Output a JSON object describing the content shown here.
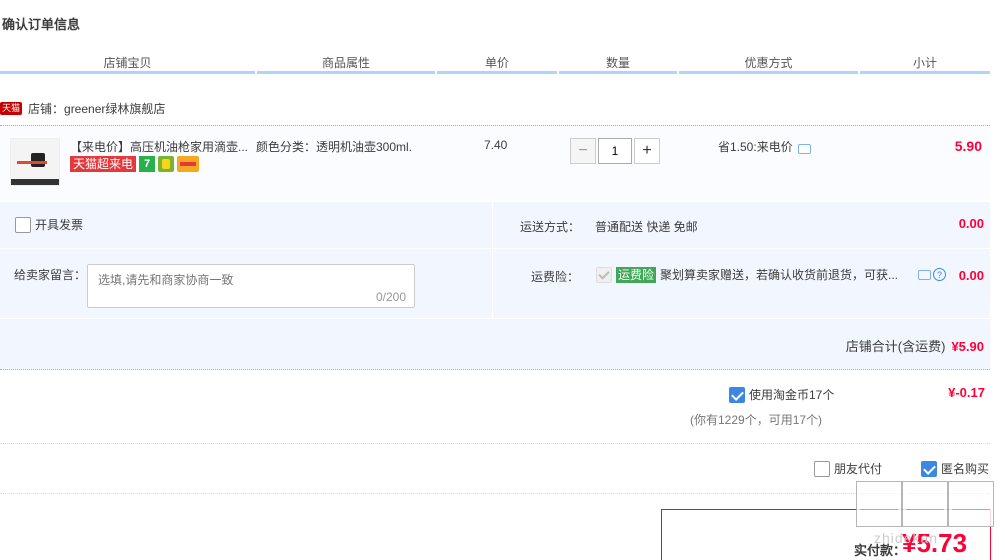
{
  "page_title": "确认订单信息",
  "columns": [
    "店铺宝贝",
    "商品属性",
    "单价",
    "数量",
    "优惠方式",
    "小计"
  ],
  "shop": {
    "tag": "天猫",
    "label": "店铺：greener绿林旗舰店"
  },
  "item": {
    "title": "【来电价】高压机油枪家用滴壶...",
    "badge_text": "天猫超来电",
    "badge_num": "7",
    "attribute": "颜色分类：透明机油壶300ml.",
    "unit_price": "7.40",
    "quantity": "1",
    "qty_minus": "−",
    "qty_plus": "+",
    "discount": "省1.50:来电价",
    "subtotal": "5.90"
  },
  "options": {
    "invoice_label": "开具发票",
    "shipping_label": "运送方式：",
    "shipping_value": "普通配送 快递 免邮",
    "shipping_fee": "0.00",
    "message_label": "给卖家留言：",
    "message_placeholder": "选填,请先和商家协商一致",
    "message_count": "0/200",
    "insurance_label": "运费险：",
    "insurance_tag": "运费险",
    "insurance_text": "聚划算卖家赠送，若确认收货前退货，可获...",
    "insurance_fee": "0.00",
    "question_mark": "?",
    "shop_total_label": "店铺合计(含运费)",
    "shop_total_amount": "¥5.90"
  },
  "coins": {
    "label": "使用淘金币17个",
    "sub": "(你有1229个，可用17个)",
    "amount": "¥-0.17"
  },
  "friend_pay_label": "朋友代付",
  "anonymous_label": "匿名购买",
  "payment": {
    "label": "实付款：",
    "amount": "¥5.73"
  },
  "watermark_text": "zhidekan"
}
